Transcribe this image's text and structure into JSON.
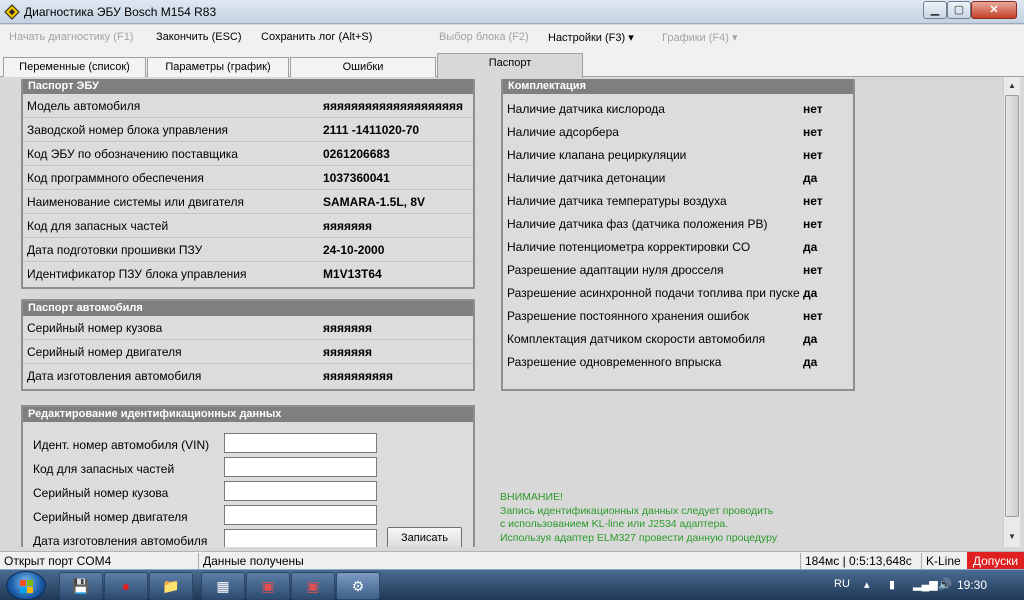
{
  "window": {
    "title": "Диагностика ЭБУ Bosch M154 R83",
    "min_glyph": "▁",
    "max_glyph": "▢",
    "close_glyph": "✕"
  },
  "menu": {
    "start_diag": "Начать диагностику (F1)",
    "finish": "Закончить (ESC)",
    "save_log": "Сохранить лог (Alt+S)",
    "select_block": "Выбор блока (F2)",
    "settings": "Настройки (F3) ▾",
    "charts": "Графики (F4) ▾"
  },
  "tabs": {
    "variables": "Переменные (список)",
    "parameters": "Параметры (график)",
    "errors": "Ошибки",
    "passport": "Паспорт"
  },
  "ecu_passport": {
    "header": "Паспорт ЭБУ",
    "rows": [
      {
        "label": "Модель автомобиля",
        "value": "яяяяяяяяяяяяяяяяяяяя"
      },
      {
        "label": "Заводской номер блока управления",
        "value": "2111 -1411020-70"
      },
      {
        "label": "Код ЭБУ по обозначению поставщика",
        "value": "0261206683"
      },
      {
        "label": "Код программного обеспечения",
        "value": "1037360041"
      },
      {
        "label": "Наименование системы или двигателя",
        "value": "SAMARA-1.5L, 8V"
      },
      {
        "label": "Код для запасных частей",
        "value": "яяяяяяя"
      },
      {
        "label": "Дата подготовки прошивки ПЗУ",
        "value": "24-10-2000"
      },
      {
        "label": "Идентификатор ПЗУ блока управления",
        "value": "M1V13T64"
      }
    ]
  },
  "car_passport": {
    "header": "Паспорт автомобиля",
    "rows": [
      {
        "label": "Серийный номер кузова",
        "value": "яяяяяяя"
      },
      {
        "label": "Серийный номер двигателя",
        "value": "яяяяяяя"
      },
      {
        "label": "Дата изготовления автомобиля",
        "value": "яяяяяяяяяя"
      }
    ]
  },
  "edit_id": {
    "header": "Редактирование идентификационных данных",
    "fields": [
      {
        "label": "Идент. номер автомобиля (VIN)",
        "value": ""
      },
      {
        "label": "Код для запасных частей",
        "value": ""
      },
      {
        "label": "Серийный номер кузова",
        "value": ""
      },
      {
        "label": "Серийный номер двигателя",
        "value": ""
      },
      {
        "label": "Дата изготовления автомобиля",
        "value": ""
      }
    ],
    "write_button": "Записать"
  },
  "equipment": {
    "header": "Комплектация",
    "rows": [
      {
        "label": "Наличие датчика кислорода",
        "value": "нет"
      },
      {
        "label": "Наличие адсорбера",
        "value": "нет"
      },
      {
        "label": "Наличие клапана рециркуляции",
        "value": "нет"
      },
      {
        "label": "Наличие датчика детонации",
        "value": "да"
      },
      {
        "label": "Наличие датчика температуры воздуха",
        "value": "нет"
      },
      {
        "label": "Наличие датчика фаз (датчика положения РВ)",
        "value": "нет"
      },
      {
        "label": "Наличие потенциометра корректировки CO",
        "value": "да"
      },
      {
        "label": "Разрешение адаптации нуля дросселя",
        "value": "нет"
      },
      {
        "label": "Разрешение асинхронной подачи топлива при пуске",
        "value": "да"
      },
      {
        "label": "Разрешение постоянного хранения ошибок",
        "value": "нет"
      },
      {
        "label": "Комплектация датчиком скорости автомобиля",
        "value": "да"
      },
      {
        "label": "Разрешение одновременного впрыска",
        "value": "да"
      }
    ]
  },
  "warning": {
    "title": "ВНИМАНИЕ!",
    "line1": "Запись идентификационных данных следует проводить",
    "line2": "с использованием KL-line или J2534 адаптера.",
    "line3": "Используя адаптер ELM327 провести данную процедуру"
  },
  "status": {
    "port": "Открыт порт COM4",
    "data": "Данные получены",
    "timing": "184мс | 0:5:13,648с",
    "protocol": "K-Line",
    "alert": "Допуски"
  },
  "taskbar": {
    "lang": "RU",
    "time": "19:30"
  },
  "colors": {
    "panel_header": "#7f7f7f",
    "warning_text": "#2a9a2a",
    "status_alert": "#e02020"
  }
}
